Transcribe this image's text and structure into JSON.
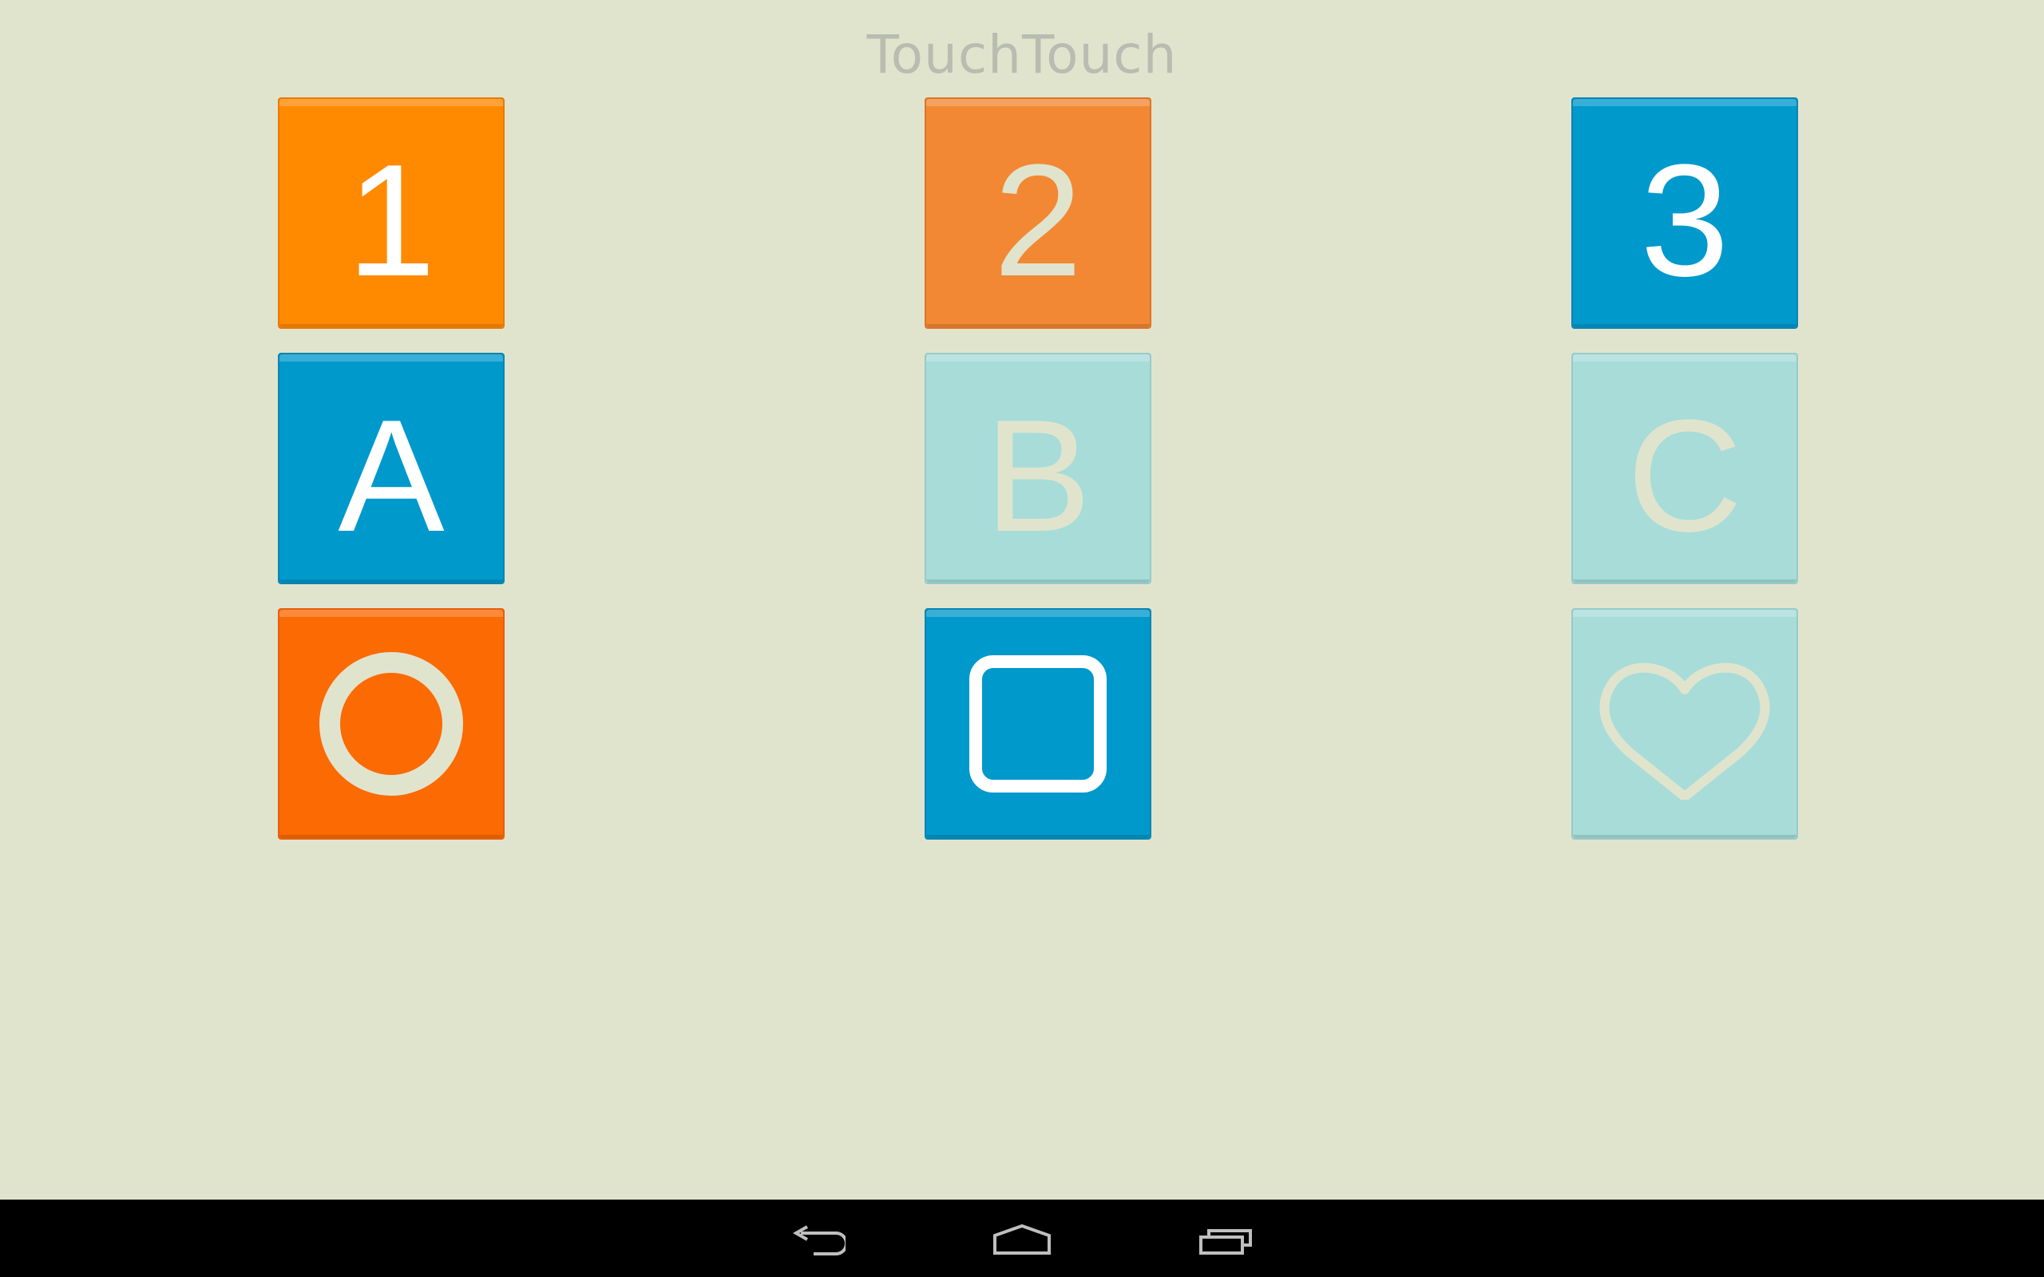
{
  "app": {
    "title": "TouchTouch"
  },
  "tiles": [
    {
      "id": "1",
      "label": "1",
      "kind": "text",
      "color": "#ff8a00",
      "text_color": "#ffffff"
    },
    {
      "id": "2",
      "label": "2",
      "kind": "text",
      "color": "#f28834",
      "text_color": "#e1e4cd"
    },
    {
      "id": "3",
      "label": "3",
      "kind": "text",
      "color": "#0099cc",
      "text_color": "#ffffff"
    },
    {
      "id": "A",
      "label": "A",
      "kind": "text",
      "color": "#0099cc",
      "text_color": "#ffffff"
    },
    {
      "id": "B",
      "label": "B",
      "kind": "text",
      "color": "#a7dcd9",
      "text_color": "#e1e4cd"
    },
    {
      "id": "C",
      "label": "C",
      "kind": "text",
      "color": "#a7dcd9",
      "text_color": "#e1e4cd"
    },
    {
      "id": "circle",
      "icon": "circle-icon",
      "kind": "icon",
      "color": "#fb6a03",
      "text_color": "#e1e4cd"
    },
    {
      "id": "square",
      "icon": "square-icon",
      "kind": "icon",
      "color": "#0099cc",
      "text_color": "#ffffff"
    },
    {
      "id": "heart",
      "icon": "heart-icon",
      "kind": "icon",
      "color": "#a7dcd9",
      "text_color": "#e1e4cd"
    }
  ],
  "navbar": {
    "buttons": [
      {
        "icon": "back-icon"
      },
      {
        "icon": "home-icon"
      },
      {
        "icon": "recents-icon"
      }
    ]
  },
  "colors": {
    "background": "#e1e4cd",
    "title": "#b9bcb0",
    "navbar": "#000000"
  }
}
